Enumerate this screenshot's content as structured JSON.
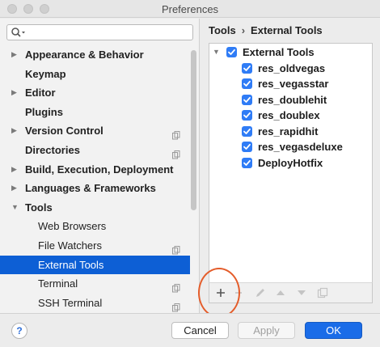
{
  "window": {
    "title": "Preferences"
  },
  "search": {
    "placeholder": ""
  },
  "sidebar": {
    "items": [
      {
        "label": "Appearance & Behavior",
        "expandable": true,
        "expanded": false,
        "has_copy_icon": false,
        "level": 0
      },
      {
        "label": "Keymap",
        "expandable": false,
        "has_copy_icon": false,
        "level": 0
      },
      {
        "label": "Editor",
        "expandable": true,
        "expanded": false,
        "has_copy_icon": false,
        "level": 0
      },
      {
        "label": "Plugins",
        "expandable": false,
        "has_copy_icon": false,
        "level": 0
      },
      {
        "label": "Version Control",
        "expandable": true,
        "expanded": false,
        "has_copy_icon": true,
        "level": 0
      },
      {
        "label": "Directories",
        "expandable": false,
        "has_copy_icon": true,
        "level": 0
      },
      {
        "label": "Build, Execution, Deployment",
        "expandable": true,
        "expanded": false,
        "has_copy_icon": false,
        "level": 0
      },
      {
        "label": "Languages & Frameworks",
        "expandable": true,
        "expanded": false,
        "has_copy_icon": false,
        "level": 0
      },
      {
        "label": "Tools",
        "expandable": true,
        "expanded": true,
        "has_copy_icon": false,
        "level": 0
      },
      {
        "label": "Web Browsers",
        "expandable": false,
        "has_copy_icon": false,
        "level": 1
      },
      {
        "label": "File Watchers",
        "expandable": false,
        "has_copy_icon": true,
        "level": 1
      },
      {
        "label": "External Tools",
        "expandable": false,
        "has_copy_icon": false,
        "level": 1,
        "selected": true
      },
      {
        "label": "Terminal",
        "expandable": false,
        "has_copy_icon": true,
        "level": 1
      },
      {
        "label": "SSH Terminal",
        "expandable": false,
        "has_copy_icon": true,
        "level": 1
      }
    ]
  },
  "breadcrumb": {
    "parent": "Tools",
    "separator": "›",
    "current": "External Tools"
  },
  "tools_tree": {
    "root": {
      "label": "External Tools",
      "checked": true,
      "expanded": true
    },
    "children": [
      {
        "label": "res_oldvegas",
        "checked": true
      },
      {
        "label": "res_vegasstar",
        "checked": true
      },
      {
        "label": "res_doublehit",
        "checked": true
      },
      {
        "label": "res_doublex",
        "checked": true
      },
      {
        "label": "res_rapidhit",
        "checked": true
      },
      {
        "label": "res_vegasdeluxe",
        "checked": true
      },
      {
        "label": "DeployHotfix",
        "checked": true
      }
    ]
  },
  "toolbar": {
    "buttons": [
      {
        "icon": "plus-icon",
        "enabled": true
      },
      {
        "icon": "minus-icon",
        "enabled": false
      },
      {
        "icon": "pencil-icon",
        "enabled": false
      },
      {
        "icon": "arrow-up-icon",
        "enabled": false
      },
      {
        "icon": "arrow-down-icon",
        "enabled": false
      },
      {
        "icon": "copy-icon",
        "enabled": false
      }
    ]
  },
  "footer": {
    "help_label": "?",
    "cancel_label": "Cancel",
    "apply_label": "Apply",
    "ok_label": "OK"
  },
  "colors": {
    "accent": "#0d5fd5",
    "checkbox": "#2f7cf6",
    "ok_button": "#1a6ce8",
    "annotation_circle": "#e45c2a"
  }
}
